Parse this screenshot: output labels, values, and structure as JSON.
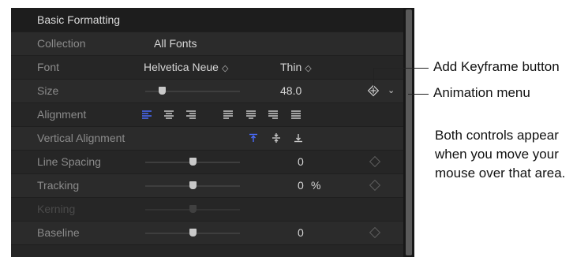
{
  "panel": {
    "section_title": "Basic Formatting",
    "rows": {
      "collection": {
        "label": "Collection",
        "value": "All Fonts"
      },
      "font": {
        "label": "Font",
        "family": "Helvetica Neue",
        "weight": "Thin"
      },
      "size": {
        "label": "Size",
        "value": "48.0",
        "slider_level": 0.18
      },
      "alignment": {
        "label": "Alignment",
        "active_index": 0,
        "buttons": [
          "align-left",
          "align-center",
          "align-right",
          "justify-left",
          "justify-center",
          "justify-right",
          "justify-full"
        ]
      },
      "vertical_alignment": {
        "label": "Vertical Alignment",
        "active_index": 0,
        "buttons": [
          "align-top",
          "align-middle",
          "align-bottom"
        ]
      },
      "line_spacing": {
        "label": "Line Spacing",
        "value": "0",
        "slider_level": 0.5
      },
      "tracking": {
        "label": "Tracking",
        "value": "0",
        "unit": "%",
        "slider_level": 0.5
      },
      "kerning": {
        "label": "Kerning",
        "slider_level": 0.5
      },
      "baseline": {
        "label": "Baseline",
        "value": "0",
        "slider_level": 0.5
      }
    }
  },
  "callouts": {
    "keyframe": "Add Keyframe button",
    "animation": "Animation menu",
    "note_line1": "Both controls appear",
    "note_line2": "when you move your",
    "note_line3": "mouse over that area."
  },
  "colors": {
    "panel_bg": "#2b2b2b",
    "header_bg": "#1d1d1d",
    "accent_blue": "#4a6cff"
  }
}
